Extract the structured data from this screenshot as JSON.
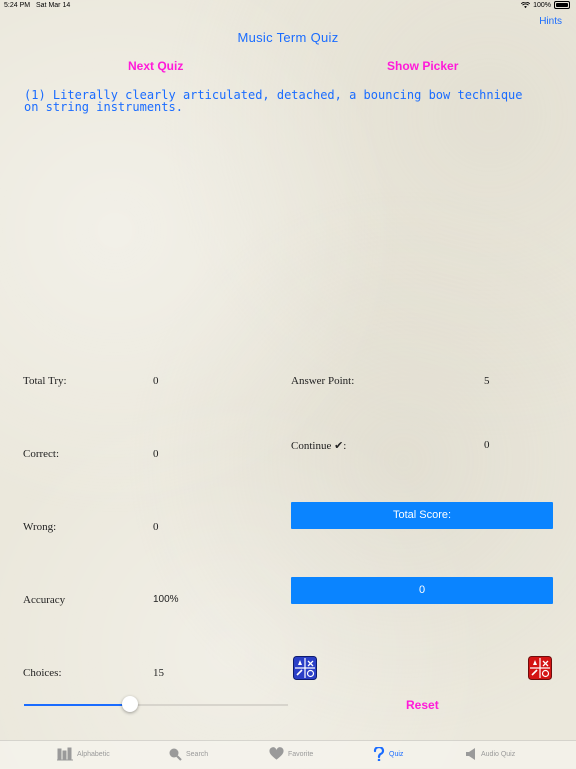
{
  "status": {
    "time": "5:24 PM",
    "date": "Sat Mar 14",
    "battery": "100%"
  },
  "header": {
    "hints": "Hints",
    "title": "Music Term Quiz",
    "next_quiz": "Next Quiz",
    "show_picker": "Show Picker"
  },
  "question": "(1) Literally clearly articulated, detached, a bouncing bow technique on string instruments.",
  "stats": {
    "total_try_label": "Total Try:",
    "total_try_value": "0",
    "correct_label": "Correct:",
    "correct_value": "0",
    "wrong_label": "Wrong:",
    "wrong_value": "0",
    "accuracy_label": "Accuracy",
    "accuracy_value": "100%",
    "choices_label": "Choices:",
    "choices_value": "15",
    "answer_point_label": "Answer Point:",
    "answer_point_value": "5",
    "continue_label": "Continue ✔:",
    "continue_value": "0"
  },
  "score": {
    "total_label": "Total Score:",
    "total_value": "0"
  },
  "slider": {
    "value_fraction": 0.4
  },
  "reset_label": "Reset",
  "tabs": [
    {
      "label": "Alphabetic",
      "icon": "alphabetic-icon"
    },
    {
      "label": "Search",
      "icon": "search-icon"
    },
    {
      "label": "Favorite",
      "icon": "heart-icon"
    },
    {
      "label": "Quiz",
      "icon": "question-icon"
    },
    {
      "label": "Audio Quiz",
      "icon": "speaker-icon"
    }
  ],
  "colors": {
    "accent": "#1a6cff",
    "magenta": "#ff1ad9",
    "score_bar": "#0a84ff",
    "quiz_icon_blue": "#2a3fc7",
    "quiz_icon_red": "#d41414"
  }
}
